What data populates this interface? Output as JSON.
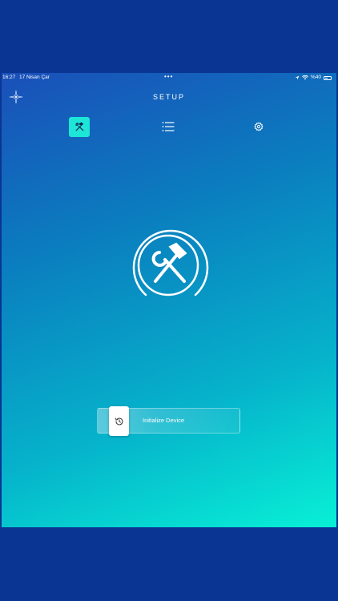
{
  "status_bar": {
    "time": "16:27",
    "date": "17 Nisan Çar",
    "dots": "•••",
    "battery_text": "%40"
  },
  "header": {
    "title": "SETUP"
  },
  "tabs": [
    {
      "name": "setup",
      "icon": "hammer-wrench-icon",
      "active": true
    },
    {
      "name": "list",
      "icon": "list-icon",
      "active": false
    },
    {
      "name": "settings",
      "icon": "gear-icon",
      "active": false
    }
  ],
  "hero": {
    "icon": "hammer-wrench-icon"
  },
  "slider": {
    "label": "Initialize Device",
    "icon": "history-icon"
  },
  "colors": {
    "background_outer": "#0a3592",
    "gradient_start": "#1a4fb9",
    "gradient_end": "#08f0d6",
    "active_tab": "#1ee6d6"
  }
}
